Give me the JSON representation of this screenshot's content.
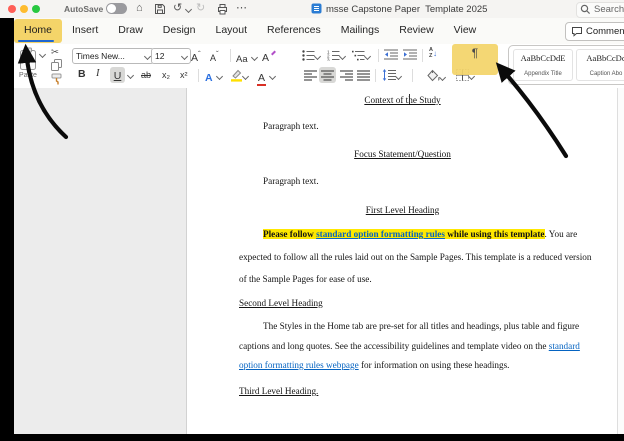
{
  "window": {
    "autosave_label": "AutoSave",
    "doc_title": "msse Capstone Paper  Template 2025",
    "search_label": "Search",
    "comments_label": "Comments"
  },
  "glyphs": {
    "home": "⌂",
    "undo": "↺",
    "redo": "↻",
    "more": "⋯",
    "scissors": "✂",
    "caret_up": "ˆ",
    "caret_down": "ˇ",
    "down_arrow": "↓"
  },
  "tabs": {
    "labels": [
      "Home",
      "Insert",
      "Draw",
      "Design",
      "Layout",
      "References",
      "Mailings",
      "Review",
      "View"
    ],
    "active": "Home"
  },
  "ribbon": {
    "paste_label": "Paste",
    "font_name": "Times New...",
    "font_size": "12",
    "bold": "B",
    "italic": "I",
    "underline": "U",
    "strikethrough": "ab",
    "subscript": "x₂",
    "superscript": "x²",
    "grow_font": "A",
    "shrink_font": "A",
    "change_case": "Aa",
    "clear_formatting": "A",
    "text_effects": "A",
    "font_color": "A",
    "pilcrow": "¶",
    "sort_a": "A",
    "sort_z": "Z",
    "styles": [
      {
        "sample": "AaBbCcDdE",
        "name": "Appendix Title"
      },
      {
        "sample": "AaBbCcDc",
        "name": "Caption Abo"
      }
    ]
  },
  "document": {
    "heading_context": "Context of the Study",
    "paragraph_text_1": "Paragraph text.",
    "heading_focus": "Focus Statement/Question",
    "paragraph_text_2": "Paragraph text.",
    "heading_first": "First Level Heading",
    "highlight_pre": "Please follow ",
    "highlight_link": "standard option formatting rules",
    "highlight_post": " while using this template",
    "sentence_after_highlight": ". You are",
    "body1_line2": "expected to follow all the rules laid out on the Sample Pages. This template is a reduced version",
    "body1_line3": "of the Sample Pages for ease of use.",
    "heading_second": "Second Level Heading",
    "body2_line1": "The Styles in the Home tab are pre-set for all titles and headings, plus table and figure",
    "body2_line2_pre": "captions and long quotes. See the accessibility guidelines and template video on the ",
    "body2_line2_link": "standard",
    "body2_line3_link": "option formatting rules webpage",
    "body2_line3_post": " for information on using these headings.",
    "heading_third": "Third Level Heading."
  },
  "colors": {
    "annotation_highlight": "#f4d469",
    "active_tab_accent": "#1e66d0",
    "hyperlink": "#0563c1",
    "text_highlight": "#ffe800"
  }
}
